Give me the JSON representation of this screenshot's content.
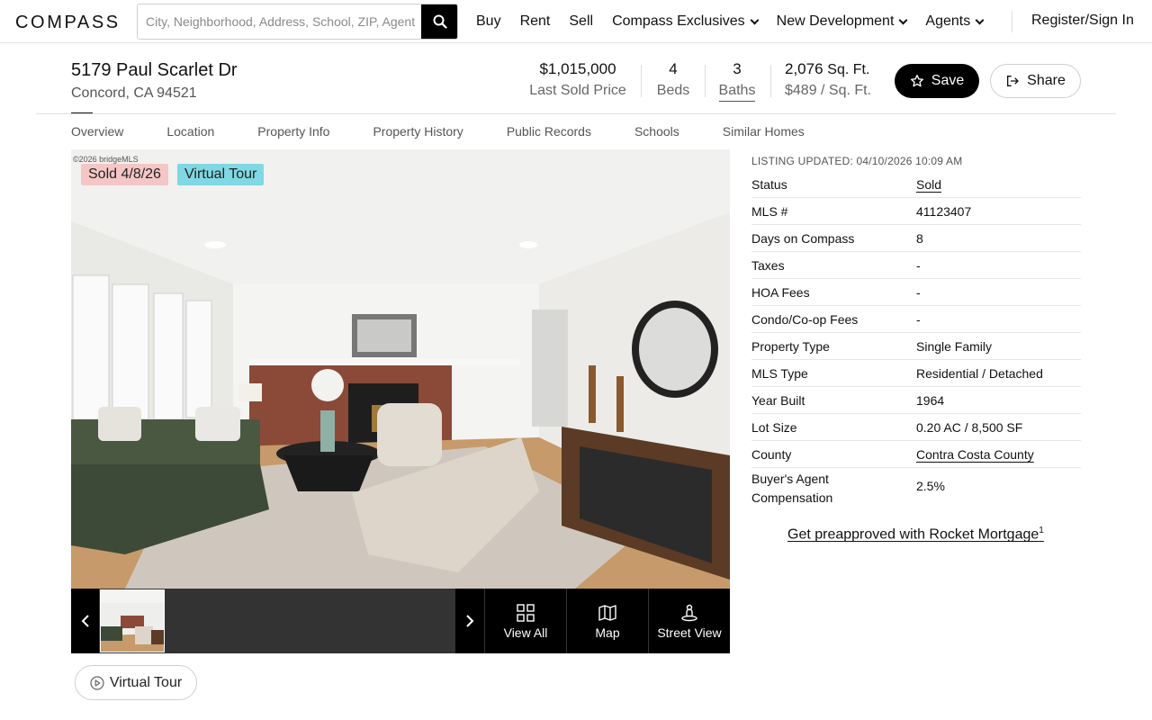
{
  "nav": {
    "logo": "COMPASS",
    "search_placeholder": "City, Neighborhood, Address, School, ZIP, Agent",
    "links": [
      "Buy",
      "Rent",
      "Sell",
      "Compass Exclusives",
      "New Development",
      "Agents"
    ],
    "signin": "Register/Sign In"
  },
  "property": {
    "address_line1": "5179 Paul Scarlet Dr",
    "address_line2": "Concord, CA 94521",
    "price": "$1,015,000",
    "price_label": "Last Sold Price",
    "beds": "4",
    "beds_label": "Beds",
    "baths": "3",
    "baths_label": "Baths",
    "sqft": "2,076",
    "sqft_unit": "Sq. Ft.",
    "price_per_sqft": "$489 / Sq. Ft.",
    "save_label": "Save",
    "share_label": "Share"
  },
  "tabs": [
    "Overview",
    "Location",
    "Property Info",
    "Property History",
    "Public Records",
    "Schools",
    "Similar Homes"
  ],
  "photo": {
    "watermark": "©2026 bridgeMLS",
    "badge_sold": "Sold 4/8/26",
    "badge_tour": "Virtual Tour",
    "view_all": "View All",
    "map": "Map",
    "street_view": "Street View",
    "virtual_tour_button": "Virtual Tour"
  },
  "details": {
    "updated": "LISTING UPDATED: 04/10/2026 10:09 AM",
    "rows": [
      {
        "key": "Status",
        "value": "Sold"
      },
      {
        "key": "MLS #",
        "value": "41123407"
      },
      {
        "key": "Days on Compass",
        "value": "8"
      },
      {
        "key": "Taxes",
        "value": "-"
      },
      {
        "key": "HOA Fees",
        "value": "-"
      },
      {
        "key": "Condo/Co-op Fees",
        "value": "-"
      },
      {
        "key": "Property Type",
        "value": "Single Family"
      },
      {
        "key": "MLS Type",
        "value": "Residential / Detached"
      },
      {
        "key": "Year Built",
        "value": "1964"
      },
      {
        "key": "Lot Size",
        "value": "0.20 AC / 8,500 SF"
      },
      {
        "key": "County",
        "value": "Contra Costa County"
      },
      {
        "key": "Buyer's Agent Compensation",
        "value": "2.5%"
      }
    ],
    "rocket_link": "Get preapproved with Rocket Mortgage",
    "rocket_sup": "1"
  }
}
